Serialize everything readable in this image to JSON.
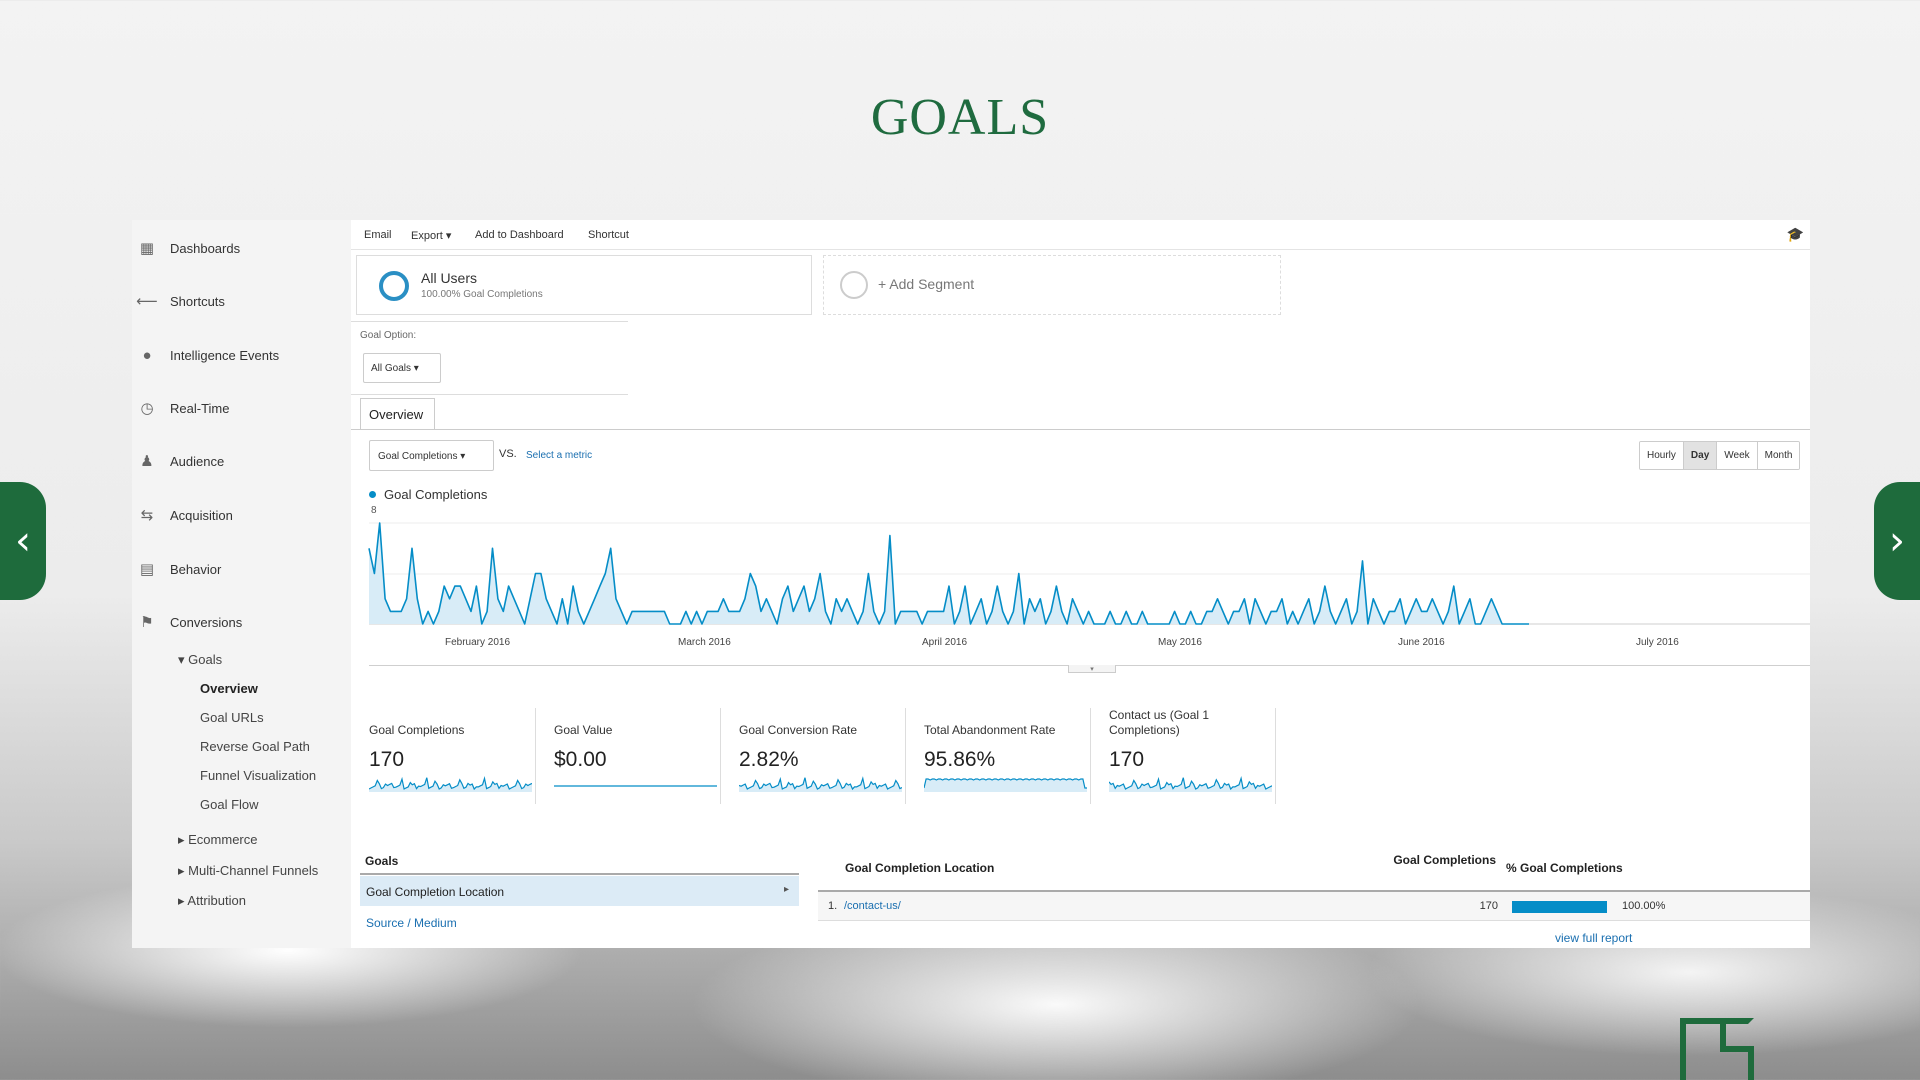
{
  "slide": {
    "title": "GOALS"
  },
  "sidebar": {
    "items": [
      {
        "label": "Dashboards",
        "icon": "grid-icon"
      },
      {
        "label": "Shortcuts",
        "icon": "shortcut-arrow-icon"
      },
      {
        "label": "Intelligence Events",
        "icon": "lightbulb-icon"
      },
      {
        "label": "Real-Time",
        "icon": "clock-icon"
      },
      {
        "label": "Audience",
        "icon": "people-icon"
      },
      {
        "label": "Acquisition",
        "icon": "acquisition-arrows-icon"
      },
      {
        "label": "Behavior",
        "icon": "behavior-window-icon"
      },
      {
        "label": "Conversions",
        "icon": "flag-icon"
      }
    ],
    "goals_label": "▾ Goals",
    "goals_sub": [
      "Overview",
      "Goal URLs",
      "Reverse Goal Path",
      "Funnel Visualization",
      "Goal Flow"
    ],
    "other_sections": [
      "▸ Ecommerce",
      "▸ Multi-Channel Funnels",
      "▸ Attribution"
    ]
  },
  "toolbar": {
    "email": "Email",
    "export": "Export ▾",
    "add_dashboard": "Add to Dashboard",
    "shortcut": "Shortcut"
  },
  "segments": {
    "all_users": "All Users",
    "all_users_sub": "100.00% Goal Completions",
    "add_segment": "+ Add Segment"
  },
  "goal_option": {
    "label": "Goal Option:",
    "value": "All Goals ▾"
  },
  "tabs": {
    "overview": "Overview"
  },
  "metric": {
    "selected": "Goal Completions ▾",
    "vs": "VS.",
    "select_metric": "Select a metric"
  },
  "periods": {
    "hourly": "Hourly",
    "day": "Day",
    "week": "Week",
    "month": "Month"
  },
  "chart": {
    "legend": "Goal Completions",
    "y_max_label": "8",
    "x_labels": [
      "February 2016",
      "March 2016",
      "April 2016",
      "May 2016",
      "June 2016",
      "July 2016"
    ]
  },
  "chart_data": {
    "type": "area",
    "series": [
      {
        "name": "Goal Completions",
        "values": [
          6,
          4,
          8,
          2,
          1,
          1,
          1,
          2,
          6,
          2,
          0,
          1,
          0,
          1,
          3,
          2,
          3,
          3,
          2,
          1,
          3,
          0,
          1,
          6,
          2,
          1,
          3,
          2,
          1,
          0,
          2,
          4,
          4,
          2,
          1,
          0,
          2,
          0,
          3,
          1,
          0,
          1,
          2,
          3,
          4,
          6,
          2,
          1,
          0,
          1,
          1,
          1,
          1,
          1,
          1,
          1,
          0,
          0,
          0,
          1,
          0,
          1,
          0,
          1,
          1,
          1,
          2,
          1,
          1,
          1,
          2,
          4,
          3,
          1,
          2,
          1,
          0,
          2,
          3,
          1,
          2,
          3,
          1,
          2,
          4,
          1,
          0,
          2,
          1,
          2,
          1,
          0,
          1,
          4,
          1,
          0,
          1,
          7,
          0,
          1,
          1,
          1,
          1,
          0,
          1,
          1,
          1,
          1,
          3,
          0,
          1,
          3,
          0,
          1,
          2,
          0,
          1,
          3,
          1,
          0,
          1,
          4,
          0,
          2,
          1,
          2,
          0,
          1,
          3,
          1,
          0,
          2,
          1,
          0,
          1,
          0,
          0,
          0,
          1,
          0,
          0,
          1,
          0,
          0,
          1,
          0,
          0,
          0,
          0,
          0,
          1,
          0,
          0,
          1,
          0,
          0,
          1,
          1,
          2,
          1,
          0,
          1,
          1,
          2,
          0,
          2,
          1,
          0,
          1,
          1,
          2,
          0,
          1,
          0,
          1,
          2,
          0,
          1,
          3,
          1,
          0,
          1,
          2,
          0,
          1,
          5,
          0,
          2,
          1,
          0,
          1,
          1,
          2,
          0,
          1,
          2,
          1,
          1,
          2,
          1,
          0,
          1,
          3,
          0,
          1,
          2,
          0,
          0,
          1,
          2,
          1,
          0,
          0,
          0,
          0,
          0,
          0
        ]
      }
    ],
    "ylim": [
      0,
      8
    ],
    "xlabel": "",
    "ylabel": ""
  },
  "scorecards": [
    {
      "label": "Goal Completions",
      "value": "170",
      "spark": "jagged"
    },
    {
      "label": "Goal Value",
      "value": "$0.00",
      "spark": "flat"
    },
    {
      "label": "Goal Conversion Rate",
      "value": "2.82%",
      "spark": "jagged"
    },
    {
      "label": "Total Abandonment Rate",
      "value": "95.86%",
      "spark": "high"
    },
    {
      "label": "Contact us (Goal 1 Completions)",
      "value": "170",
      "spark": "jagged"
    }
  ],
  "goals_panel": {
    "title": "Goals",
    "selected": "Goal Completion Location",
    "source_medium": "Source / Medium"
  },
  "table": {
    "col_location": "Goal Completion Location",
    "col_completions": "Goal Completions",
    "col_pct": "% Goal Completions",
    "rows": [
      {
        "num": "1.",
        "page": "/contact-us/",
        "completions": "170",
        "pct": "100.00%",
        "pct_value": 100
      }
    ],
    "full_report": "view full report"
  },
  "colors": {
    "accent_blue": "#058dc7",
    "brand_green": "#1f6b3f"
  }
}
